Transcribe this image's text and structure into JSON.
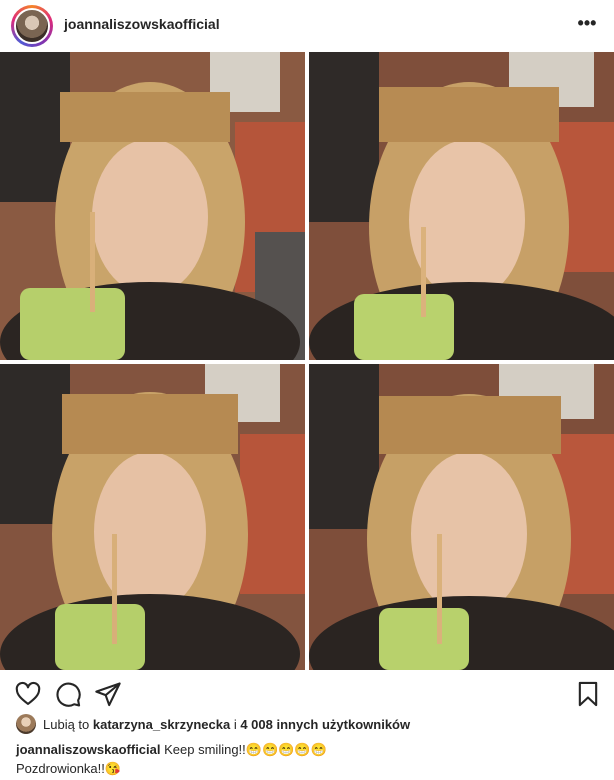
{
  "post": {
    "username": "joannaliszowskaofficial",
    "more_icon": "•••",
    "likes": {
      "prefix": "Lubią to ",
      "first_liker": "katarzyna_skrzynecka",
      "middle": " i ",
      "others": "4 008 innych użytkowników"
    },
    "caption": {
      "username": "joannaliszowskaofficial",
      "line1": "Keep smiling!!😁😁😁😁😁",
      "line2": "Pozdrowionka!!😘"
    }
  },
  "icons": {
    "like": "heart-icon",
    "comment": "comment-bubble-icon",
    "share": "paper-plane-icon",
    "save": "bookmark-icon"
  },
  "colors": {
    "text": "#262626",
    "story_ring": [
      "#f58529",
      "#dd2a7b",
      "#8134af",
      "#515bd4"
    ]
  }
}
